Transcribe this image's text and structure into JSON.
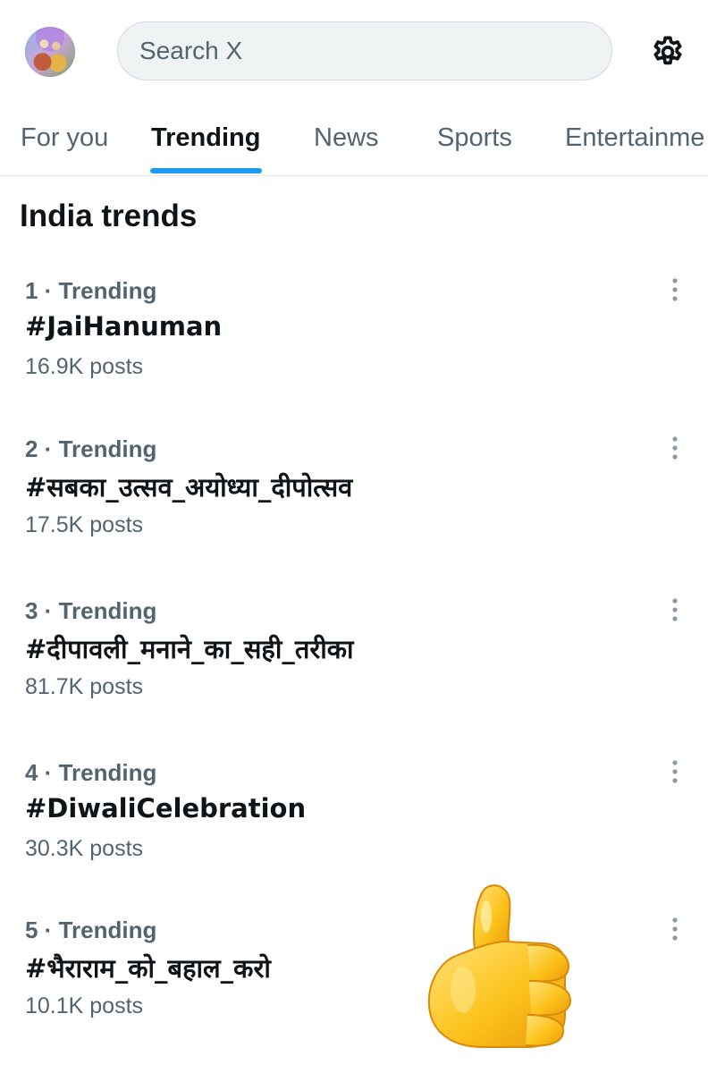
{
  "search": {
    "placeholder": "Search X"
  },
  "tabs": [
    {
      "label": "For you"
    },
    {
      "label": "Trending"
    },
    {
      "label": "News"
    },
    {
      "label": "Sports"
    },
    {
      "label": "Entertainme"
    }
  ],
  "active_tab": "Trending",
  "section": {
    "title": "India trends"
  },
  "trends": [
    {
      "meta": "1 · Trending",
      "tag": "#JaiHanuman",
      "posts": "16.9K posts"
    },
    {
      "meta": "2 · Trending",
      "tag": "#सबका_उत्सव_अयोध्या_दीपोत्सव",
      "posts": "17.5K posts"
    },
    {
      "meta": "3 · Trending",
      "tag": "#दीपावली_मनाने_का_सही_तरीका",
      "posts": "81.7K posts"
    },
    {
      "meta": "4 · Trending",
      "tag": "#DiwaliCelebration",
      "posts": "30.3K posts"
    },
    {
      "meta": "5 · Trending",
      "tag": "#भैराराम_को_बहाल_करो",
      "posts": "10.1K posts"
    }
  ],
  "icons": {
    "gear": "gear-icon",
    "more": "more-vertical-icon",
    "thumbs": "thumbs-up-emoji"
  },
  "colors": {
    "accent": "#1d9bf0",
    "secondary_text": "#536471",
    "primary_text": "#0f1419"
  }
}
